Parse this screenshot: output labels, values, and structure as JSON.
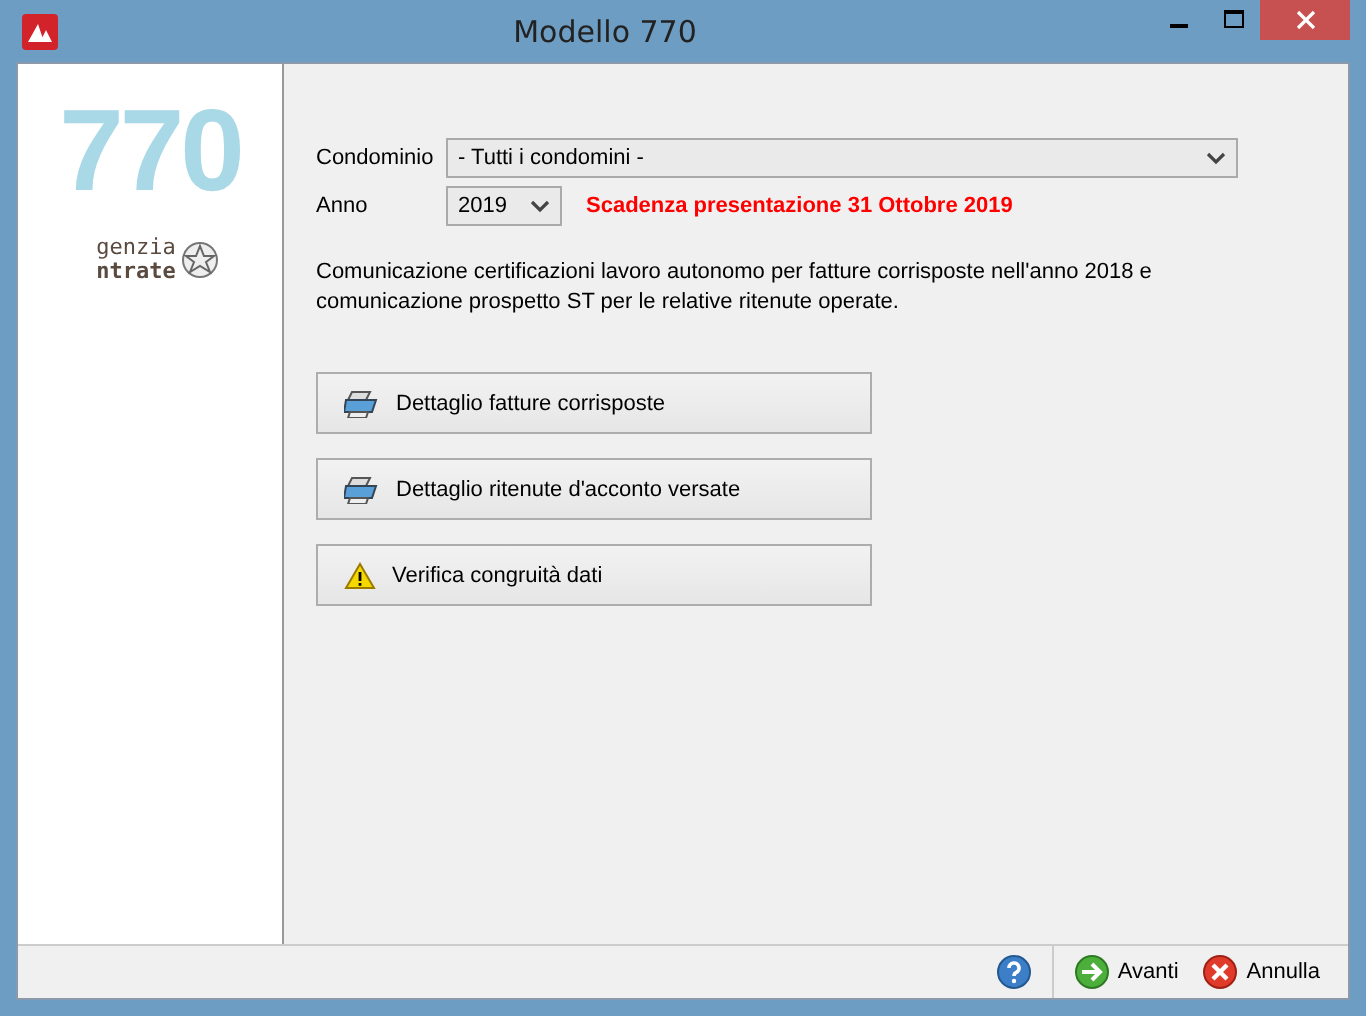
{
  "window": {
    "title": "Modello 770"
  },
  "sidebar": {
    "logo_number": "770",
    "agency_lines": [
      "genzia",
      "ntrate"
    ]
  },
  "form": {
    "condominio": {
      "label": "Condominio",
      "value": "- Tutti i condomini -"
    },
    "anno": {
      "label": "Anno",
      "value": "2019"
    },
    "deadline": "Scadenza presentazione 31 Ottobre 2019"
  },
  "description": "Comunicazione certificazioni lavoro autonomo per fatture corrisposte nell'anno 2018 e comunicazione prospetto ST per le relative ritenute operate.",
  "actions": [
    {
      "kind": "printer",
      "label": "Dettaglio fatture corrisposte"
    },
    {
      "kind": "printer",
      "label": "Dettaglio ritenute d'acconto versate"
    },
    {
      "kind": "warning",
      "label": "Verifica congruità dati"
    }
  ],
  "footer": [
    {
      "kind": "help"
    },
    {
      "kind": "next",
      "label": "Avanti"
    },
    {
      "kind": "cancel",
      "label": "Annulla"
    }
  ]
}
